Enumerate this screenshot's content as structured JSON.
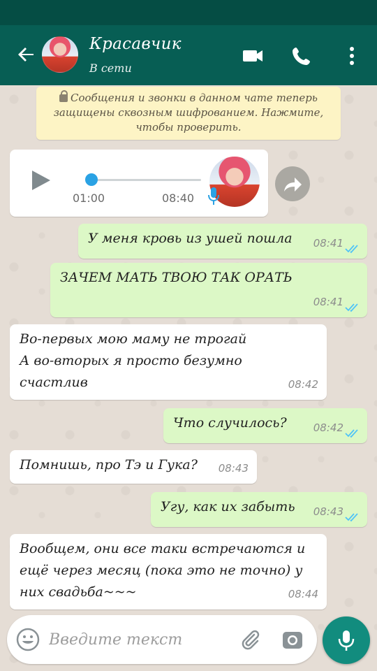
{
  "header": {
    "contact_name": "Красавчик",
    "contact_status": "В сети",
    "colors": {
      "statusbar": "#054d44",
      "appbar": "#075e54"
    },
    "icons": [
      "arrow-back-icon",
      "video-call-icon",
      "phone-icon",
      "more-vert-icon"
    ]
  },
  "system_notice": "Сообщения и звонки в данном чате теперь защищены сквозным шифрованием. Нажмите, чтобы проверить.",
  "voice_message": {
    "current_time": "01:00",
    "time": "08:40",
    "progress": 0.0
  },
  "messages": [
    {
      "dir": "out",
      "text": "У меня кровь из ушей пошла",
      "time": "08:41"
    },
    {
      "dir": "out",
      "text": "ЗАЧЕМ МАТЬ ТВОЮ ТАК ОРАТЬ",
      "time": "08:41"
    },
    {
      "dir": "in",
      "line1": "Во-первых мою маму не трогай",
      "line2": "А во-вторых я просто безумно",
      "line3": "счастлив",
      "time": "08:42"
    },
    {
      "dir": "out",
      "text": "Что случилось?",
      "time": "08:42"
    },
    {
      "dir": "in",
      "text": "Помнишь, про Тэ и Гука?",
      "time": "08:43"
    },
    {
      "dir": "out",
      "text": "Угу, как их забыть",
      "time": "08:43"
    },
    {
      "dir": "in",
      "line1": "Вообщем, они все таки встречаются и",
      "line2": "ещё через месяц (пока это не точно) у",
      "line3": "них свадьба~~~",
      "time": "08:44"
    }
  ],
  "composer": {
    "placeholder": "Введите текст",
    "accent": "#128c7e"
  }
}
